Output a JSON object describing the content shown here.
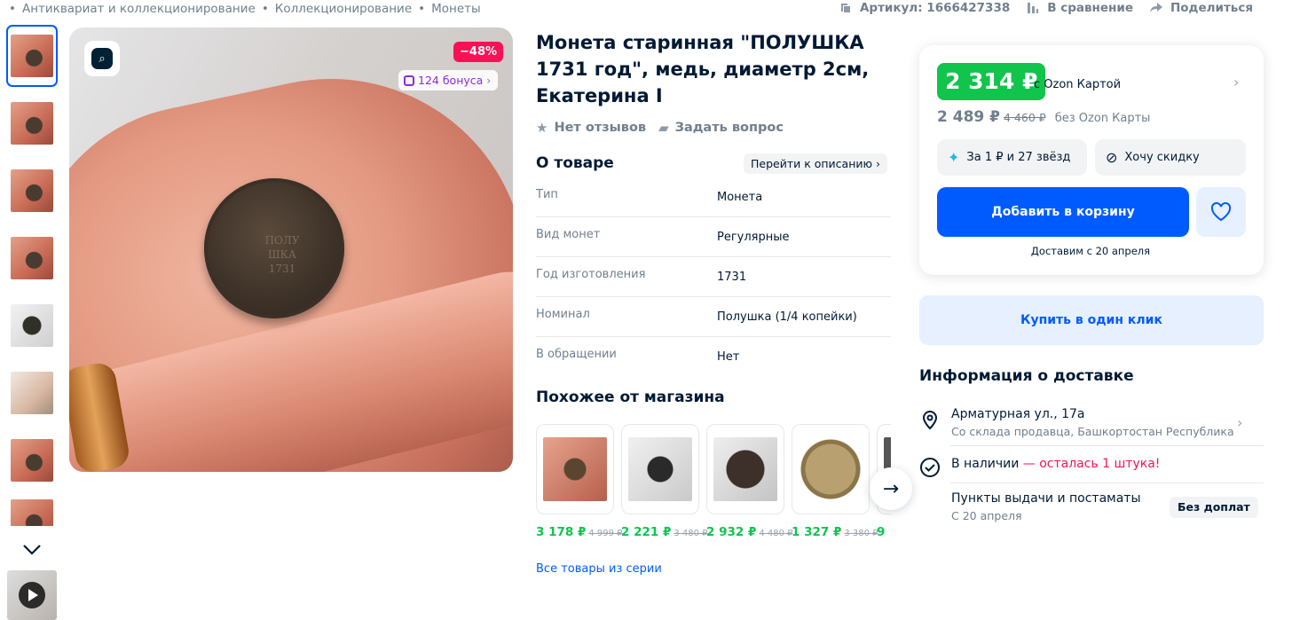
{
  "breadcrumbs": [
    "Антиквариат и коллекционирование",
    "Коллекционирование",
    "Монеты"
  ],
  "topbar": {
    "article": "Артикул: 1666427338",
    "compare": "В сравнение",
    "share": "Поделиться"
  },
  "gallery": {
    "discount": "−48%",
    "bonus": "124 бонуса",
    "coin_inscription": [
      "ПОЛУ",
      "ШКА",
      "1731"
    ]
  },
  "product": {
    "title": "Монета старинная \"ПОЛУШКА 1731 год\", медь, диаметр 2см, Екатерина I",
    "reviews": "Нет отзывов",
    "ask": "Задать вопрос"
  },
  "about": {
    "heading": "О товаре",
    "goto": "Перейти к описанию",
    "specs": [
      {
        "k": "Тип",
        "v": "Монета"
      },
      {
        "k": "Вид монет",
        "v": "Регулярные"
      },
      {
        "k": "Год изготовления",
        "v": "1731"
      },
      {
        "k": "Номинал",
        "v": "Полушка (1/4 копейки)"
      },
      {
        "k": "В обращении",
        "v": "Нет"
      }
    ]
  },
  "similar": {
    "heading": "Похожее от магазина",
    "items": [
      {
        "price": "3 178 ₽",
        "old": "4 999 ₽"
      },
      {
        "price": "2 221 ₽",
        "old": "3 480 ₽"
      },
      {
        "price": "2 932 ₽",
        "old": "4 480 ₽"
      },
      {
        "price": "1 327 ₽",
        "old": "3 380 ₽"
      },
      {
        "price": "9",
        "old": ""
      }
    ],
    "all_series": "Все товары из серии"
  },
  "buy": {
    "ozon_price": "2 314 ₽",
    "ozon_card": "с Ozon Картой",
    "price": "2 489 ₽",
    "old_price": "4 460 ₽",
    "without_card": "без Ozon Карты",
    "stars": "За 1 ₽ и 27 звёзд",
    "want_discount": "Хочу скидку",
    "add_to_cart": "Добавить в корзину",
    "delivery_date": "Доставим с 20 апреля",
    "one_click": "Купить в один клик"
  },
  "delivery": {
    "heading": "Информация о доставке",
    "address": "Арматурная ул., 17а",
    "warehouse": "Со склада продавца, Башкортостан Республика",
    "stock_prefix": "В наличии",
    "stock_left": " — осталась 1 штука!",
    "pickup": "Пункты выдачи и постаматы",
    "pickup_date": "С 20 апреля",
    "no_extra": "Без доплат"
  },
  "colors": {
    "accent": "#005bff",
    "green": "#10c44c",
    "pink": "#f91155"
  }
}
